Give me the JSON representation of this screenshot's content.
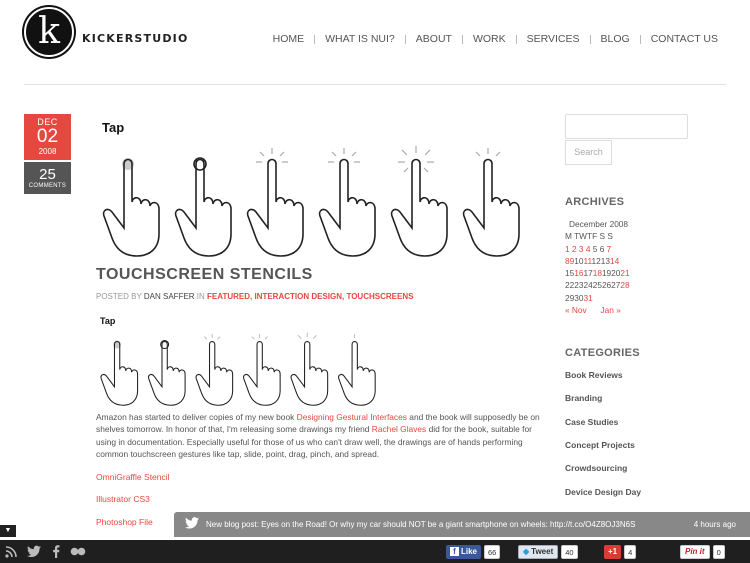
{
  "header": {
    "logo_letter": "k",
    "brand": "KICKERSTUDIO",
    "nav": [
      "HOME",
      "WHAT IS NUI?",
      "ABOUT",
      "WORK",
      "SERVICES",
      "BLOG",
      "CONTACT US"
    ]
  },
  "post": {
    "date": {
      "month": "DEC",
      "day": "02",
      "year": "2008"
    },
    "comments": {
      "count": "25",
      "label": "COMMENTS"
    },
    "image_label": "Tap",
    "title": "TOUCHSCREEN STENCILS",
    "meta": {
      "posted_by": "POSTED BY",
      "author": "DAN SAFFER",
      "in": "IN",
      "categories": [
        "FEATURED",
        "INTERACTION DESIGN",
        "TOUCHSCREENS"
      ]
    },
    "small_image_label": "Tap",
    "body": {
      "p1": "Amazon has started to deliver copies of my new book ",
      "link1": "Designing Gestural Interfaces",
      "p2": " and the book will supposedly be on shelves tomorrow. In honor of that, I'm releasing some drawings my friend ",
      "link2": "Rachel Glaves",
      "p3": " did for the book, suitable for using in documentation. Especially useful for those of us who can't draw well, the drawings are of hands performing common touchscreen gestures like tap, slide, point, drag, pinch, and spread."
    },
    "files": [
      "OmniGraffle Stencil",
      "Illustrator CS3",
      "Photoshop File"
    ]
  },
  "sidebar": {
    "search_button": "Search",
    "archives_title": "ARCHIVES",
    "calendar": {
      "caption": "December 2008",
      "weekdays": [
        "M",
        "T",
        "W",
        "T",
        "F",
        "S",
        "S"
      ],
      "rows": [
        [
          "1",
          "2",
          "3",
          "4",
          "5",
          "6",
          "7"
        ],
        [
          "8",
          "9",
          "10",
          "11",
          "12",
          "13",
          "14"
        ],
        [
          "15",
          "16",
          "17",
          "18",
          "19",
          "20",
          "21"
        ],
        [
          "22",
          "23",
          "24",
          "25",
          "26",
          "27",
          "28"
        ],
        [
          "29",
          "30",
          "31"
        ]
      ],
      "linked_days": [
        "1",
        "2",
        "3",
        "4",
        "7",
        "8",
        "9",
        "11",
        "14",
        "16",
        "18",
        "21",
        "28",
        "31"
      ],
      "prev": "« Nov",
      "next": "Jan »"
    },
    "categories_title": "CATEGORIES",
    "categories": [
      "Book Reviews",
      "Branding",
      "Case Studies",
      "Concept Projects",
      "Crowdsourcing",
      "Device Design Day"
    ]
  },
  "tweetbar": {
    "message": "New blog post: Eyes on the Road! Or why my car should NOT be a giant smartphone on wheels: http://t.co/O4Z8OJ3N6S",
    "time": "4 hours ago"
  },
  "bottombar": {
    "like": {
      "label": "Like",
      "count": "66"
    },
    "tweet": {
      "label": "Tweet",
      "count": "40"
    },
    "plus": {
      "label": "+1",
      "count": "4"
    },
    "pin": {
      "label": "Pin it",
      "count": "0"
    }
  },
  "colors": {
    "accent": "#e5483f",
    "dark_bar": "#1f1f1f",
    "tweet_bar": "#888888"
  }
}
